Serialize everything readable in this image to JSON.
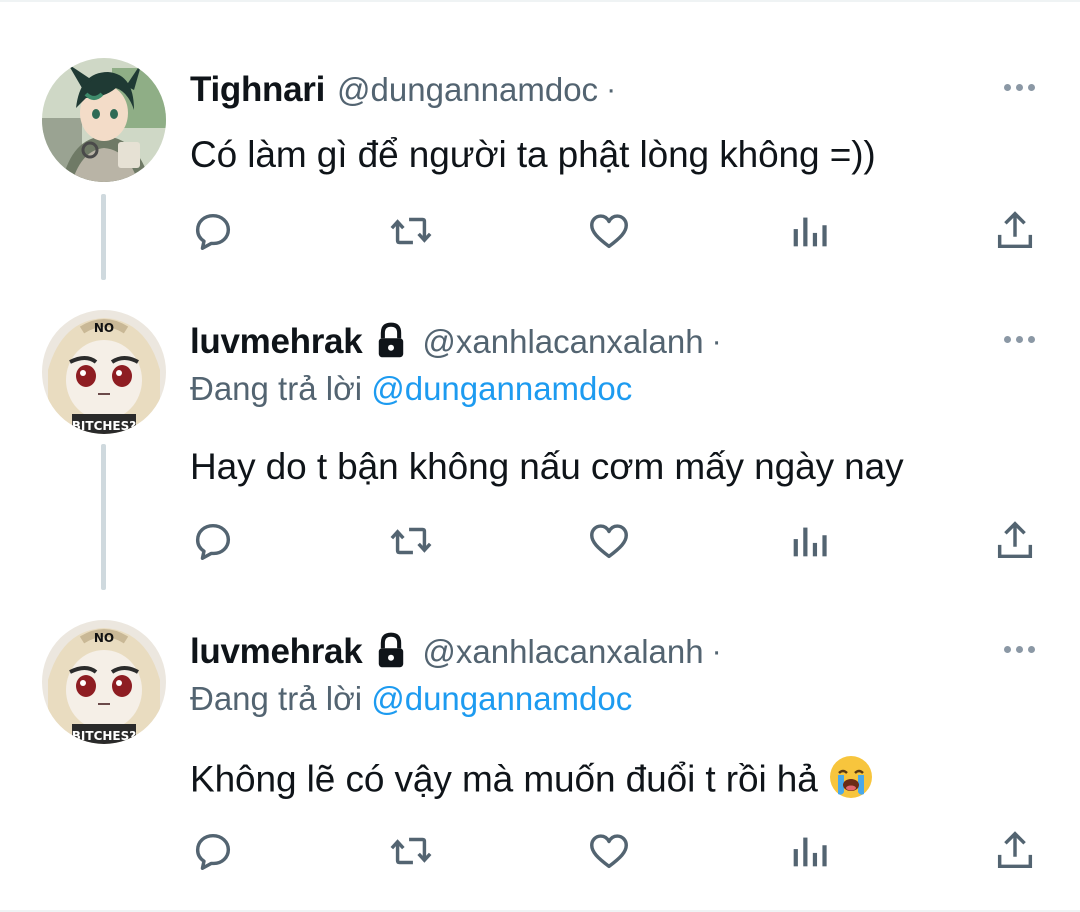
{
  "tweets": [
    {
      "name": "Tighnari",
      "handle": "@dungannamdoc",
      "dot": "·",
      "locked": false,
      "replying_prefix": "",
      "replying_to": "",
      "text": "Có làm gì để người ta phật lòng không =))",
      "emoji": ""
    },
    {
      "name": "luvmehrak",
      "handle": "@xanhlacanxalanh",
      "dot": "·",
      "locked": true,
      "replying_prefix": "Đang trả lời",
      "replying_to": "@dungannamdoc",
      "text": "Hay do t bận không nấu cơm mấy ngày nay",
      "emoji": ""
    },
    {
      "name": "luvmehrak",
      "handle": "@xanhlacanxalanh",
      "dot": "·",
      "locked": true,
      "replying_prefix": "Đang trả lời",
      "replying_to": "@dungannamdoc",
      "text": "Không lẽ có vậy mà muốn đuổi t rồi hả",
      "emoji": "loudly-crying-face"
    }
  ],
  "avatar_text": {
    "top": "NO",
    "bottom": "BITCHES?"
  },
  "colors": {
    "text": "#0f1419",
    "secondary": "#536471",
    "accent": "#1d9bf0",
    "icon": "#536471",
    "thread_line": "#cfd9de"
  },
  "icons": [
    "reply-icon",
    "retweet-icon",
    "like-icon",
    "views-icon",
    "share-icon",
    "more-icon",
    "lock-icon"
  ]
}
